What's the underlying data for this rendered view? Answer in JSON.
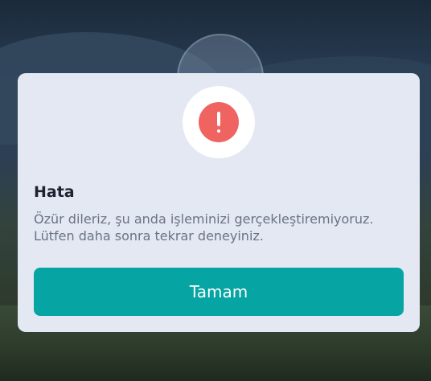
{
  "dialog": {
    "icon": "exclamation-icon",
    "title": "Hata",
    "message_line1": "Özür dileriz, şu anda işleminizi gerçekleştiremiyoruz.",
    "message_line2": "Lütfen daha sonra tekrar deneyiniz.",
    "ok_label": "Tamam"
  },
  "colors": {
    "accent": "#06a4a2",
    "error": "#ef6461",
    "dialog_background": "#e3e8f3",
    "title_text": "#1d2330",
    "message_text": "#6b7383"
  }
}
